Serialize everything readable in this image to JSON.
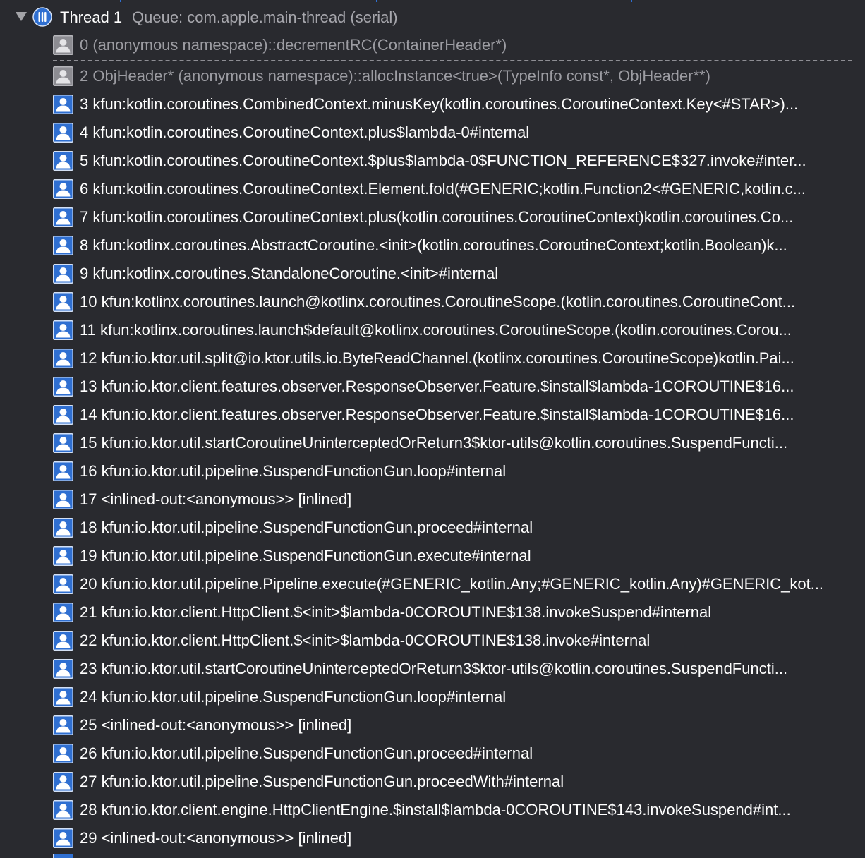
{
  "colors": {
    "background": "#292a2f",
    "user_frame_icon": "#2f6fd1",
    "system_frame_icon": "#8c8c92",
    "dim_text": "#9c9ca2",
    "queue_text": "#a7a7ad"
  },
  "thread": {
    "expanded": true,
    "disclosure_icon": "disclosure-triangle-down",
    "icon": "thread-icon",
    "title": "Thread 1",
    "queue": "Queue: com.apple.main-thread (serial)"
  },
  "frames": [
    {
      "text": "0 (anonymous namespace)::decrementRC(ContainerHeader*)",
      "kind": "system",
      "icon": "person-icon"
    },
    {
      "text": "2 ObjHeader* (anonymous namespace)::allocInstance<true>(TypeInfo const*, ObjHeader**)",
      "kind": "system",
      "icon": "person-icon",
      "collapsed_frames_above": true
    },
    {
      "text": "3 kfun:kotlin.coroutines.CombinedContext.minusKey(kotlin.coroutines.CoroutineContext.Key<#STAR>)...",
      "kind": "user",
      "icon": "person-icon"
    },
    {
      "text": "4 kfun:kotlin.coroutines.CoroutineContext.plus$lambda-0#internal",
      "kind": "user",
      "icon": "person-icon"
    },
    {
      "text": "5 kfun:kotlin.coroutines.CoroutineContext.$plus$lambda-0$FUNCTION_REFERENCE$327.invoke#inter...",
      "kind": "user",
      "icon": "person-icon"
    },
    {
      "text": "6 kfun:kotlin.coroutines.CoroutineContext.Element.fold(#GENERIC;kotlin.Function2<#GENERIC,kotlin.c...",
      "kind": "user",
      "icon": "person-icon"
    },
    {
      "text": "7 kfun:kotlin.coroutines.CoroutineContext.plus(kotlin.coroutines.CoroutineContext)kotlin.coroutines.Co...",
      "kind": "user",
      "icon": "person-icon"
    },
    {
      "text": "8 kfun:kotlinx.coroutines.AbstractCoroutine.<init>(kotlin.coroutines.CoroutineContext;kotlin.Boolean)k...",
      "kind": "user",
      "icon": "person-icon"
    },
    {
      "text": "9 kfun:kotlinx.coroutines.StandaloneCoroutine.<init>#internal",
      "kind": "user",
      "icon": "person-icon"
    },
    {
      "text": "10 kfun:kotlinx.coroutines.launch@kotlinx.coroutines.CoroutineScope.(kotlin.coroutines.CoroutineCont...",
      "kind": "user",
      "icon": "person-icon"
    },
    {
      "text": "11 kfun:kotlinx.coroutines.launch$default@kotlinx.coroutines.CoroutineScope.(kotlin.coroutines.Corou...",
      "kind": "user",
      "icon": "person-icon"
    },
    {
      "text": "12 kfun:io.ktor.util.split@io.ktor.utils.io.ByteReadChannel.(kotlinx.coroutines.CoroutineScope)kotlin.Pai...",
      "kind": "user",
      "icon": "person-icon"
    },
    {
      "text": "13 kfun:io.ktor.client.features.observer.ResponseObserver.Feature.$install$lambda-1COROUTINE$16...",
      "kind": "user",
      "icon": "person-icon"
    },
    {
      "text": "14 kfun:io.ktor.client.features.observer.ResponseObserver.Feature.$install$lambda-1COROUTINE$16...",
      "kind": "user",
      "icon": "person-icon"
    },
    {
      "text": "15 kfun:io.ktor.util.startCoroutineUninterceptedOrReturn3$ktor-utils@kotlin.coroutines.SuspendFuncti...",
      "kind": "user",
      "icon": "person-icon"
    },
    {
      "text": "16 kfun:io.ktor.util.pipeline.SuspendFunctionGun.loop#internal",
      "kind": "user",
      "icon": "person-icon"
    },
    {
      "text": "17 <inlined-out:<anonymous>> [inlined]",
      "kind": "user",
      "icon": "person-icon"
    },
    {
      "text": "18 kfun:io.ktor.util.pipeline.SuspendFunctionGun.proceed#internal",
      "kind": "user",
      "icon": "person-icon"
    },
    {
      "text": "19 kfun:io.ktor.util.pipeline.SuspendFunctionGun.execute#internal",
      "kind": "user",
      "icon": "person-icon"
    },
    {
      "text": "20 kfun:io.ktor.util.pipeline.Pipeline.execute(#GENERIC_kotlin.Any;#GENERIC_kotlin.Any)#GENERIC_kot...",
      "kind": "user",
      "icon": "person-icon"
    },
    {
      "text": "21 kfun:io.ktor.client.HttpClient.$<init>$lambda-0COROUTINE$138.invokeSuspend#internal",
      "kind": "user",
      "icon": "person-icon"
    },
    {
      "text": "22 kfun:io.ktor.client.HttpClient.$<init>$lambda-0COROUTINE$138.invoke#internal",
      "kind": "user",
      "icon": "person-icon"
    },
    {
      "text": "23 kfun:io.ktor.util.startCoroutineUninterceptedOrReturn3$ktor-utils@kotlin.coroutines.SuspendFuncti...",
      "kind": "user",
      "icon": "person-icon"
    },
    {
      "text": "24 kfun:io.ktor.util.pipeline.SuspendFunctionGun.loop#internal",
      "kind": "user",
      "icon": "person-icon"
    },
    {
      "text": "25 <inlined-out:<anonymous>> [inlined]",
      "kind": "user",
      "icon": "person-icon"
    },
    {
      "text": "26 kfun:io.ktor.util.pipeline.SuspendFunctionGun.proceed#internal",
      "kind": "user",
      "icon": "person-icon"
    },
    {
      "text": "27 kfun:io.ktor.util.pipeline.SuspendFunctionGun.proceedWith#internal",
      "kind": "user",
      "icon": "person-icon"
    },
    {
      "text": "28 kfun:io.ktor.client.engine.HttpClientEngine.$install$lambda-0COROUTINE$143.invokeSuspend#int...",
      "kind": "user",
      "icon": "person-icon"
    },
    {
      "text": "29 <inlined-out:<anonymous>> [inlined]",
      "kind": "user",
      "icon": "person-icon"
    }
  ]
}
